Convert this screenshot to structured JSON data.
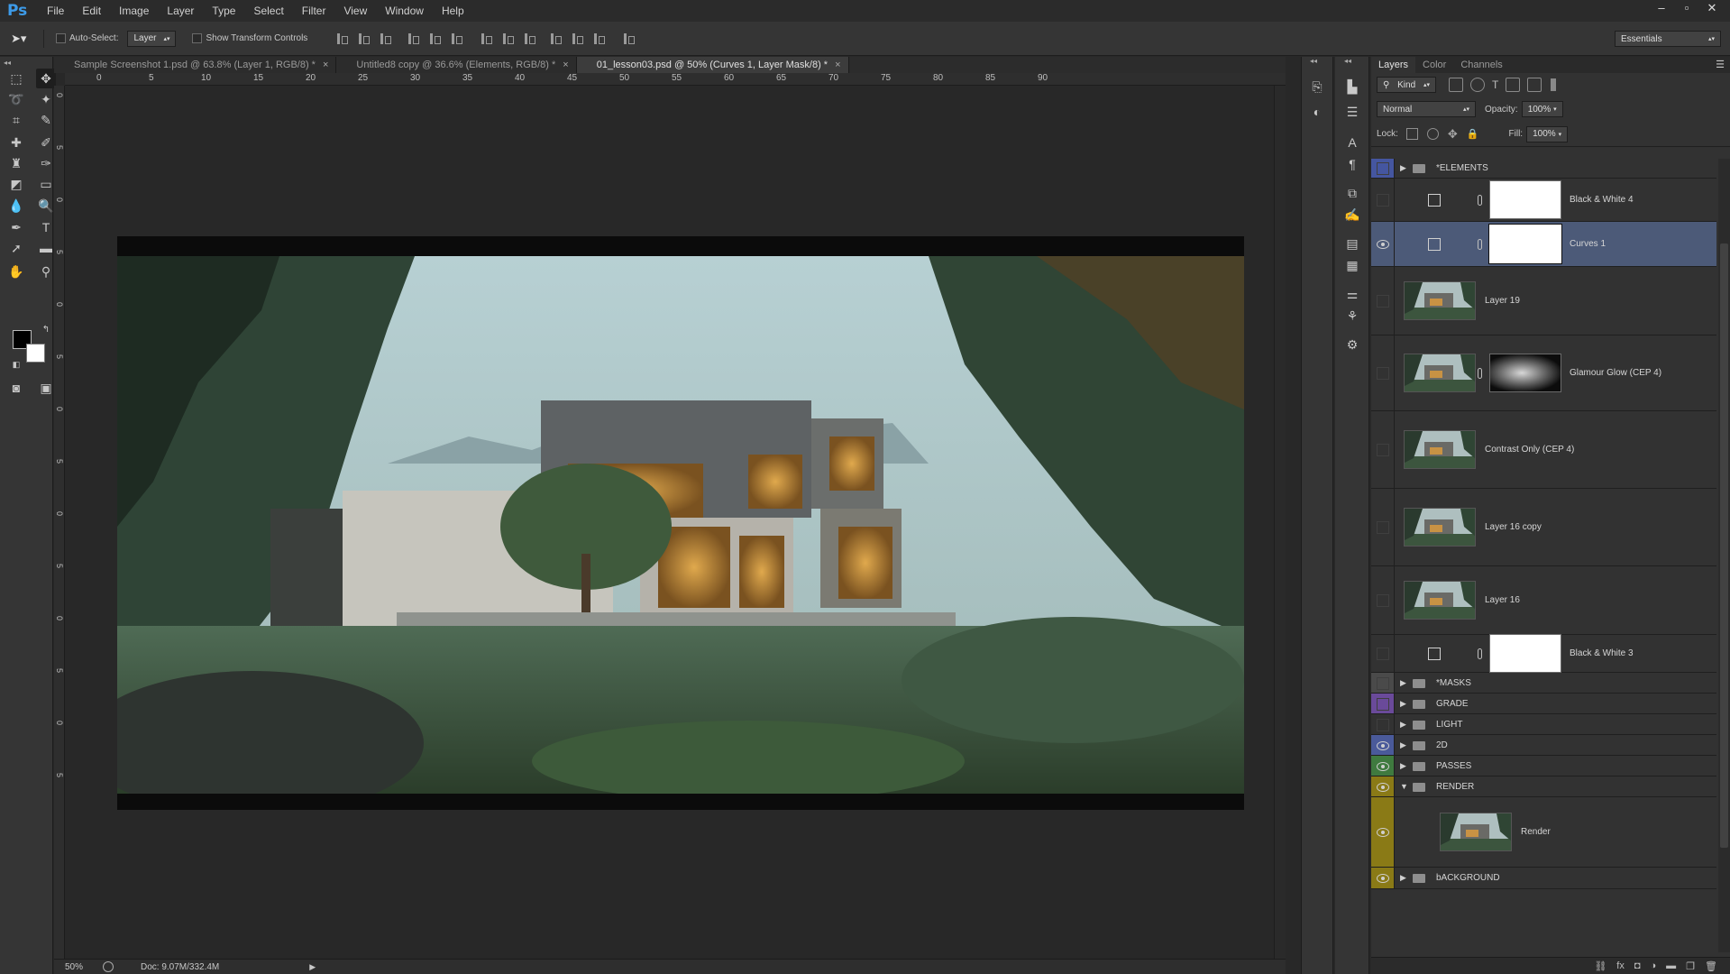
{
  "app": {
    "logo": "Ps"
  },
  "menu": [
    "File",
    "Edit",
    "Image",
    "Layer",
    "Type",
    "Select",
    "Filter",
    "View",
    "Window",
    "Help"
  ],
  "window_controls": {
    "minimize": "‒",
    "restore": "▫",
    "close": "✕"
  },
  "options": {
    "auto_select_label": "Auto-Select:",
    "auto_select_value": "Layer",
    "transform_label": "Show Transform Controls",
    "workspace": "Essentials"
  },
  "tabs": [
    {
      "label": "Sample Screenshot 1.psd @ 63.8% (Layer 1, RGB/8) *",
      "close": "×",
      "active": false
    },
    {
      "label": "Untitled8 copy @ 36.6% (Elements, RGB/8) *",
      "close": "×",
      "active": false
    },
    {
      "label": "01_lesson03.psd @ 50% (Curves 1, Layer Mask/8) *",
      "close": "×",
      "active": true
    }
  ],
  "ruler": {
    "horizontal": [
      "0",
      "5",
      "10",
      "15",
      "20",
      "25",
      "30",
      "35",
      "40",
      "45",
      "50",
      "55",
      "60",
      "65",
      "70",
      "75",
      "80",
      "85",
      "90"
    ],
    "vertical": [
      "0",
      "5",
      "0",
      "5",
      "0",
      "5",
      "0",
      "5",
      "0",
      "5",
      "0",
      "5",
      "0",
      "5"
    ]
  },
  "status": {
    "zoom": "50%",
    "doc": "Doc: 9.07M/332.4M"
  },
  "layers_panel": {
    "tabs": [
      "Layers",
      "Color",
      "Channels"
    ],
    "filter_kind": "Kind",
    "blend_mode": "Normal",
    "opacity_label": "Opacity:",
    "opacity_value": "100%",
    "lock_label": "Lock:",
    "fill_label": "Fill:",
    "fill_value": "100%",
    "layers": [
      {
        "name": "*ELEMENTS",
        "type": "group",
        "visible": false,
        "swatch": "#4556a0"
      },
      {
        "name": "Black & White 4",
        "type": "adjustment",
        "visible": false
      },
      {
        "name": "Curves 1",
        "type": "adjustment",
        "visible": true,
        "selected": true
      },
      {
        "name": "Layer 19",
        "type": "pixel",
        "visible": false
      },
      {
        "name": "Glamour Glow (CEP 4)",
        "type": "pixel-mask",
        "visible": false
      },
      {
        "name": "Contrast Only (CEP 4)",
        "type": "pixel",
        "visible": false
      },
      {
        "name": "Layer 16 copy",
        "type": "pixel",
        "visible": false
      },
      {
        "name": "Layer 16",
        "type": "pixel",
        "visible": false
      },
      {
        "name": "Black & White 3",
        "type": "adjustment",
        "visible": false
      },
      {
        "name": "*MASKS",
        "type": "group",
        "visible": false,
        "swatch": "#4a4a4a"
      },
      {
        "name": "GRADE",
        "type": "group",
        "visible": false,
        "swatch": "#6a4a9a"
      },
      {
        "name": "LIGHT",
        "type": "group",
        "visible": false,
        "swatch": ""
      },
      {
        "name": "2D",
        "type": "group",
        "visible": true,
        "swatch": "#4a5a9a"
      },
      {
        "name": "PASSES",
        "type": "group",
        "visible": true,
        "swatch": "#3f7a3f"
      },
      {
        "name": "RENDER",
        "type": "group-open",
        "visible": true,
        "swatch": "#8a7a16"
      },
      {
        "name": "Render",
        "type": "pixel",
        "visible": true,
        "swatch": "#8a7a16"
      },
      {
        "name": "bACKGROUND",
        "type": "group",
        "visible": true,
        "swatch": "#8a7a16"
      }
    ]
  }
}
